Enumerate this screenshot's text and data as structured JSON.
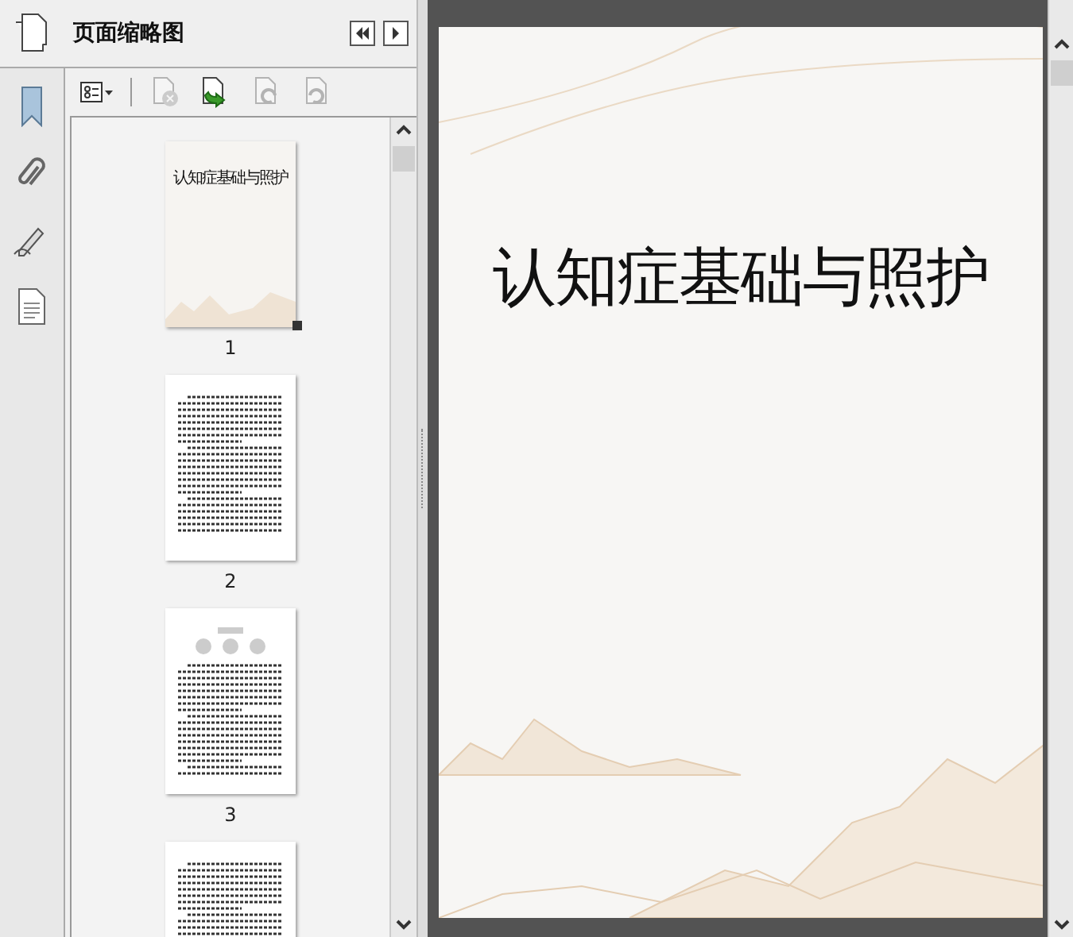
{
  "panel": {
    "title": "页面缩略图"
  },
  "toolbar": [
    {
      "kind": "options",
      "disabled": false
    },
    {
      "kind": "delete",
      "disabled": true
    },
    {
      "kind": "insert",
      "disabled": false
    },
    {
      "kind": "rotate-left",
      "disabled": true
    },
    {
      "kind": "rotate-right",
      "disabled": true
    }
  ],
  "thumbnails": [
    {
      "kind": "cover",
      "label": "1",
      "title": "认知症基础与照护"
    },
    {
      "kind": "text",
      "label": "2"
    },
    {
      "kind": "diagram",
      "label": "3"
    },
    {
      "kind": "text"
    }
  ],
  "document": {
    "title": "认知症基础与照护"
  }
}
